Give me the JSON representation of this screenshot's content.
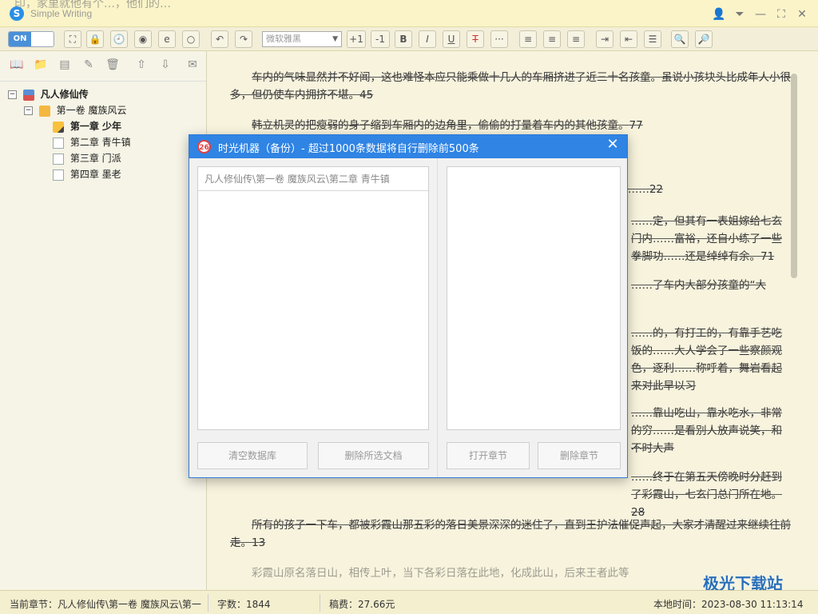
{
  "window": {
    "title": "Simple Writing",
    "title_overflow": "印，家里就他有个…，他们的…"
  },
  "toolbar": {
    "toggle_label": "ON",
    "font": "微软雅黑",
    "plus_one": "+1",
    "minus_one": "-1",
    "bold": "B",
    "italic": "I",
    "underline": "U",
    "strike": "T",
    "more": "···"
  },
  "tree": {
    "book": "凡人修仙传",
    "volume": "第一卷  魔族风云",
    "chapters": [
      "第一章  少年",
      "第二章  青牛镇",
      "第三章  门派",
      "第四章  墨老"
    ]
  },
  "editor": {
    "paragraphs": [
      "车内的气味显然并不好闻，这也难怪本应只能乘做十几人的车厢挤进了近三十名孩童。虽说小孩块头比成年人小很多，但仍使车内拥挤不堪。45",
      "韩立机灵的把瘦弱的身子缩到车厢内的边角里，偷偷的打量着车内的其他孩童。77",
      "……22",
      "……定，但其有一表姐嫁给七玄门内……富裕，还自小练了一些拳脚功……还是绰绰有余。71",
      "……了车内大部分孩童的“大",
      "……的，有打工的，有靠手艺吃饭的……大人学会了一些察颜观色，逐利……称呼着，舞岩看起来对此早以习",
      "……靠山吃山，靠水吃水，非常的穷……是看别人放声说笑，和不时大声",
      "……终于在第五天傍晚时分赶到了彩霞山，七玄门总门所在地。28",
      "所有的孩子一下车，都被彩霞山那五彩的落日美景深深的迷住了，直到王护法催促声起，大家才清醒过来继续往前走。13",
      "彩霞山原名落日山，相传上叶，当下各彩日落在此地，化成此山，后来王者此等"
    ]
  },
  "dialog": {
    "badge": "26",
    "title": "时光机器（备份）- 超过1000条数据将自行删除前500条",
    "path": "凡人修仙传\\第一卷 魔族风云\\第二章 青牛镇",
    "buttons": {
      "clear": "清空数据库",
      "delete_docs": "删除所选文档",
      "open": "打开章节",
      "delete_chapter": "删除章节"
    }
  },
  "status": {
    "current": "当前章节：凡人修仙传\\第一卷 魔族风云\\第一",
    "words": "字数：1844",
    "fee": "稿费：27.66元",
    "time": "本地时间：2023-08-30 11:13:14"
  },
  "watermark": "极光下载站"
}
